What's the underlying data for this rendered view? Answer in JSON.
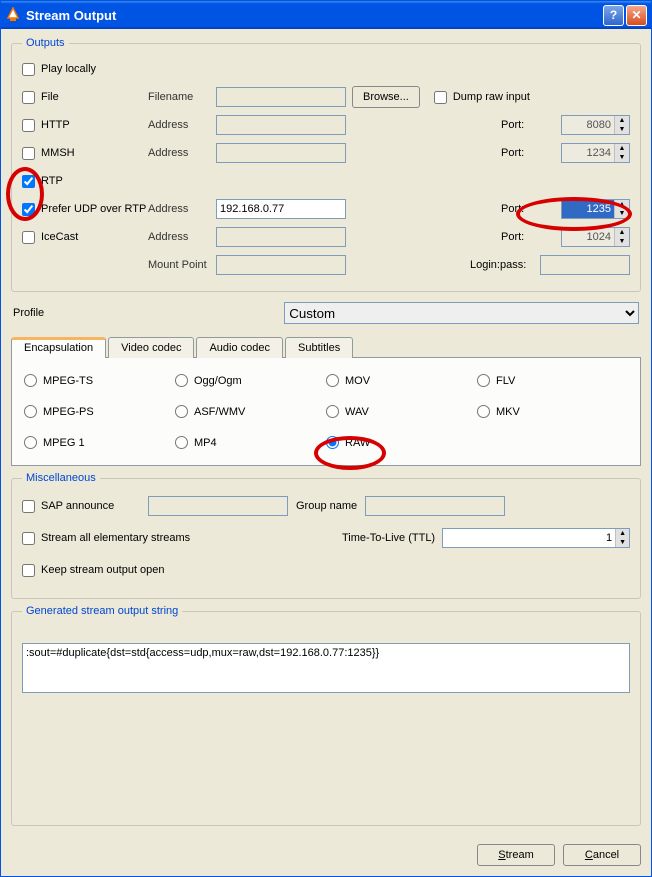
{
  "window": {
    "title": "Stream Output"
  },
  "outputs": {
    "legend": "Outputs",
    "play_locally": "Play locally",
    "file": "File",
    "filename_label": "Filename",
    "browse": "Browse...",
    "dump_raw": "Dump raw input",
    "http": "HTTP",
    "mmsh": "MMSH",
    "rtp": "RTP",
    "prefer_udp": "Prefer UDP over RTP",
    "icecast": "IceCast",
    "address_label": "Address",
    "port_label": "Port:",
    "mount_label": "Mount Point",
    "login_label": "Login:pass:",
    "http_port": "8080",
    "mmsh_port": "1234",
    "rtp_addr": "192.168.0.77",
    "rtp_port": "1235",
    "ice_port": "1024"
  },
  "profile": {
    "label": "Profile",
    "value": "Custom"
  },
  "tabs": {
    "encap": "Encapsulation",
    "vcodec": "Video codec",
    "acodec": "Audio codec",
    "subs": "Subtitles"
  },
  "encap": {
    "mpegts": "MPEG-TS",
    "ogg": "Ogg/Ogm",
    "mov": "MOV",
    "flv": "FLV",
    "mpegps": "MPEG-PS",
    "asf": "ASF/WMV",
    "wav": "WAV",
    "mkv": "MKV",
    "mpeg1": "MPEG 1",
    "mp4": "MP4",
    "raw": "RAW"
  },
  "misc": {
    "legend": "Miscellaneous",
    "sap": "SAP announce",
    "group_label": "Group name",
    "stream_all": "Stream all elementary streams",
    "ttl_label": "Time-To-Live (TTL)",
    "ttl_val": "1",
    "keep_open": "Keep stream output open"
  },
  "gen": {
    "legend": "Generated stream output string",
    "value": ":sout=#duplicate{dst=std{access=udp,mux=raw,dst=192.168.0.77:1235}}"
  },
  "buttons": {
    "stream": "Stream",
    "cancel": "Cancel"
  }
}
